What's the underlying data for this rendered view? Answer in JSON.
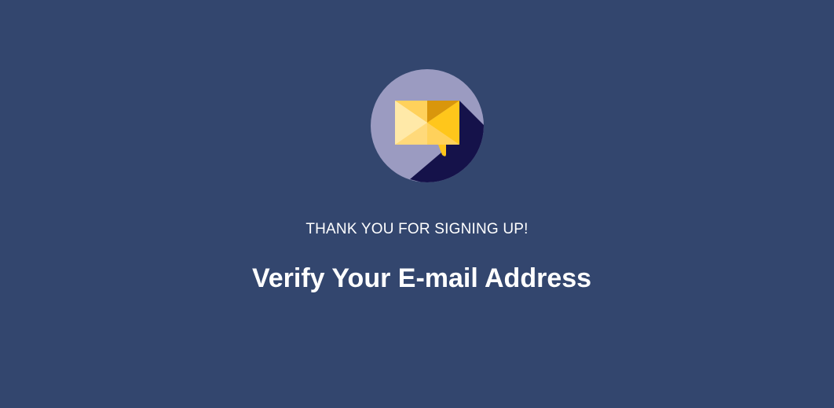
{
  "hero": {
    "icon": "email-envelope-icon",
    "subtitle": "THANK YOU FOR SIGNING UP!",
    "title": "Verify Your E-mail Address"
  },
  "colors": {
    "background": "#33466e",
    "badge_circle": "#9b9bc1",
    "badge_shadow": "#15124a",
    "envelope_light": "#ffe597",
    "envelope_mid": "#ffd15b",
    "envelope_dark": "#d9960c",
    "envelope_yellow": "#ffc61b",
    "text": "#ffffff"
  }
}
